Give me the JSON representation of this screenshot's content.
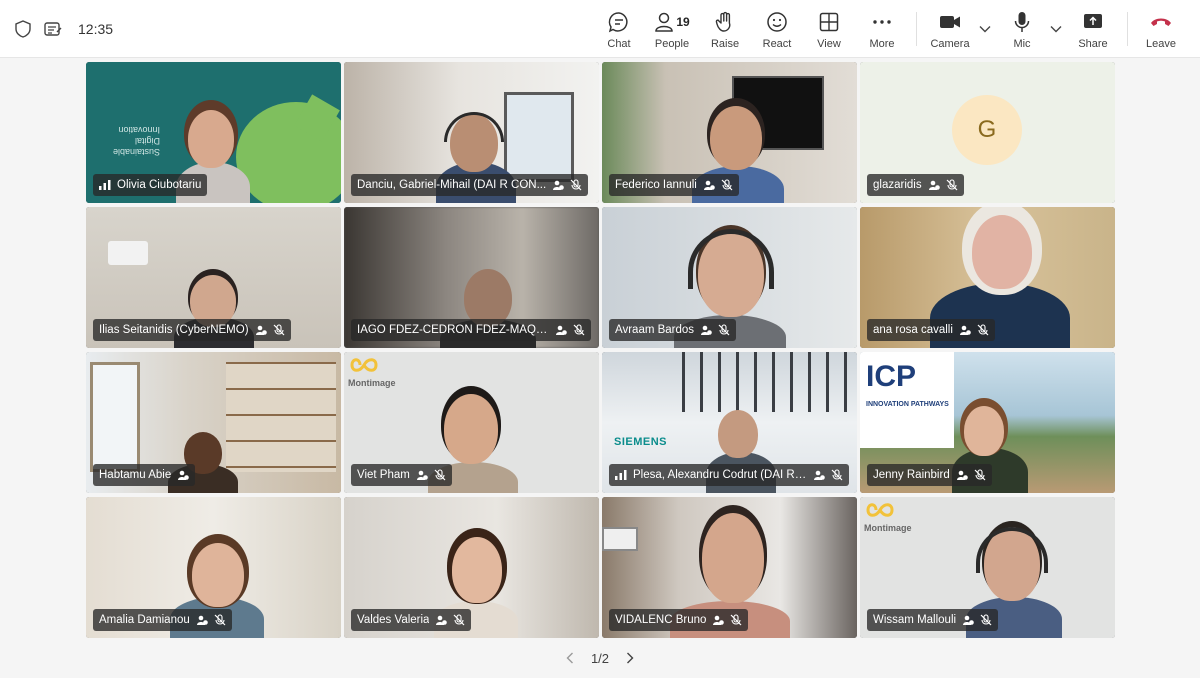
{
  "header": {
    "time": "12:35",
    "shield_icon": "shield-icon",
    "notes_icon": "notes-icon"
  },
  "toolbar": {
    "chat": "Chat",
    "people": "People",
    "people_count": "19",
    "raise": "Raise",
    "react": "React",
    "view": "View",
    "more": "More",
    "camera": "Camera",
    "mic": "Mic",
    "share": "Share",
    "leave": "Leave"
  },
  "colors": {
    "leave": "#c4314b",
    "accent": "#5b5fc7"
  },
  "participants": [
    {
      "name": "Olivia Ciubotariu",
      "speaking": true
    },
    {
      "name": "Danciu, Gabriel-Mihail (DAI R CON..."
    },
    {
      "name": "Federico Iannuli"
    },
    {
      "name": "glazaridis",
      "avatar_letter": "G"
    },
    {
      "name": "Ilias Seitanidis (CyberNEMO)"
    },
    {
      "name": "IAGO FDEZ-CEDRON FDEZ-MAQU..."
    },
    {
      "name": "Avraam Bardos"
    },
    {
      "name": "ana rosa cavalli"
    },
    {
      "name": "Habtamu Abie"
    },
    {
      "name": "Viet Pham"
    },
    {
      "name": "Plesa, Alexandru Codrut (DAI R CO..."
    },
    {
      "name": "Jenny Rainbird"
    },
    {
      "name": "Amalia Damianou"
    },
    {
      "name": "Valdes Valeria"
    },
    {
      "name": "VIDALENC Bruno"
    },
    {
      "name": "Wissam Mallouli"
    }
  ],
  "tile_text": {
    "olivia_bg": "Sustainable Digital Innovation",
    "montimage": "Montimage",
    "siemens": "SIEMENS",
    "icp": "ICP",
    "icp_sub": "INNOVATION PATHWAYS"
  },
  "pager": {
    "label": "1/2"
  }
}
